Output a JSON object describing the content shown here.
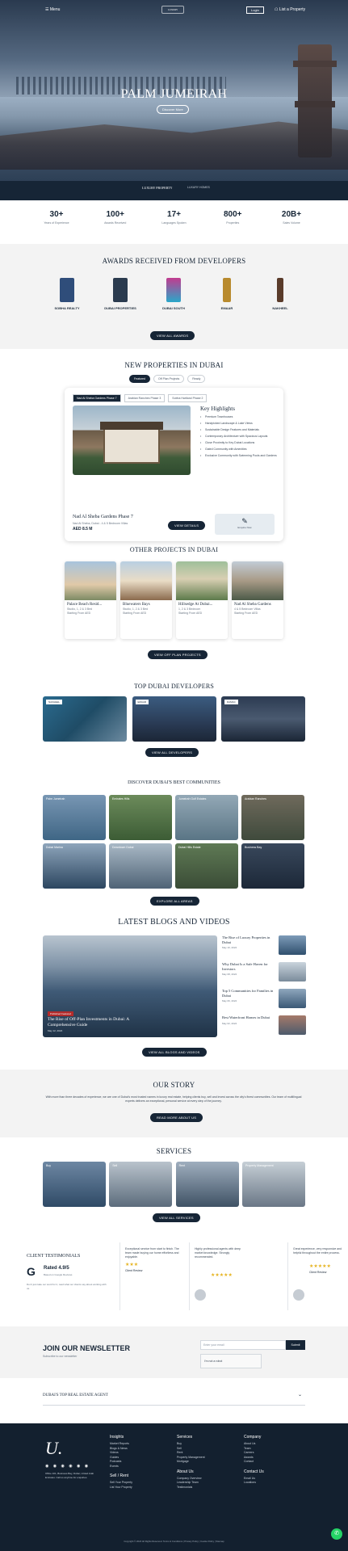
{
  "header": {
    "menu": "☰ Menu",
    "logo": "LUXURY",
    "login": "Login",
    "list_property": "☖ List a Property"
  },
  "hero": {
    "title": "PALM JUMEIRAH",
    "cta": "Discover More",
    "brand": "LUXURY PROPERTY",
    "brand2": "LUXURY HOMES"
  },
  "stats": [
    {
      "num": "30+",
      "label": "Years of Experience"
    },
    {
      "num": "100+",
      "label": "Awards Received"
    },
    {
      "num": "17+",
      "label": "Languages Spoken"
    },
    {
      "num": "800+",
      "label": "Properties"
    },
    {
      "num": "20B+",
      "label": "Sales Volume"
    }
  ],
  "awards": {
    "title": "AWARDS RECEIVED FROM DEVELOPERS",
    "items": [
      {
        "name": "SOBHA REALTY",
        "color": "#2f4d7a"
      },
      {
        "name": "DUBAI PROPERTIES",
        "color": "#2b3b4f"
      },
      {
        "name": "DUBAI SOUTH",
        "color": "#c23b8f"
      },
      {
        "name": "EMAAR",
        "color": "#b88a2e"
      },
      {
        "name": "NAKHEEL",
        "color": "#5a3b2a"
      }
    ],
    "cta": "View All Awards"
  },
  "new_properties": {
    "title": "NEW PROPERTIES IN DUBAI",
    "tabs": [
      "Featured",
      "Off Plan Projects",
      "Ready"
    ],
    "subtabs": [
      "Nad Al Sheba Gardens Phase 7",
      "Arabian Ranches Phase 3",
      "Sobha Hartland Phase 2"
    ],
    "highlights_title": "Key Highlights",
    "highlights": [
      "Premium Townhouses",
      "Handpicked Landscape & Lake Views",
      "Sustainable Design Features and Materials",
      "Contemporary Architecture with Spacious Layouts",
      "Close Proximity to Key Dubai Locations",
      "Gated Community with Amenities",
      "Exclusive Community with Swimming Pools and Gardens"
    ],
    "property_title": "Nad Al Sheba Gardens Phase 7",
    "property_loc": "Nad Al Sheba, Dubai - 4 & 5 Bedroom Villas",
    "property_price": "AED 8.5 M",
    "property_cta": "View Details",
    "enquire": "Enquire Now"
  },
  "other_projects": {
    "title": "OTHER PROJECTS IN DUBAI",
    "items": [
      {
        "title": "Palace Beach Resid...",
        "desc1": "Studio, 1, 2 & 3 Bed",
        "desc2": "Starting From AED"
      },
      {
        "title": "Bluewaters Bays",
        "desc1": "Studio, 1, 2 & 3 Bed",
        "desc2": "Starting From AED"
      },
      {
        "title": "Hillsedge At Dubai...",
        "desc1": "1, 2 & 3 Bedroom",
        "desc2": "Starting From AED"
      },
      {
        "title": "Nad Al Sheba Gardens",
        "desc1": "4 & 5 Bedroom Villas",
        "desc2": "Starting From AED"
      }
    ],
    "cta": "View Off Plan Projects"
  },
  "developers": {
    "title": "TOP DUBAI DEVELOPERS",
    "items": [
      "NAKHEEL",
      "EMAAR",
      "DAMAC"
    ],
    "cta": "View All Developers"
  },
  "communities": {
    "title": "DISCOVER DUBAI'S BEST COMMUNITIES",
    "items": [
      "Palm Jumeirah",
      "Emirates Hills",
      "Jumeirah Golf Estates",
      "Arabian Ranches",
      "Dubai Marina",
      "Downtown Dubai",
      "Dubai Hills Estate",
      "Business Bay"
    ],
    "cta": "Explore All Areas"
  },
  "blogs": {
    "title": "LATEST BLOGS AND VIDEOS",
    "main": {
      "tag": "Published Featured",
      "title": "The Rise of Off-Plan Investments in Dubai: A Comprehensive Guide",
      "date": "May 12, 2024"
    },
    "items": [
      {
        "title": "The Rise of Luxury Properties in Dubai",
        "date": "May 10, 2024"
      },
      {
        "title": "Why Dubai Is a Safe Haven for Investors",
        "date": "May 08, 2024"
      },
      {
        "title": "Top 5 Communities for Families in Dubai",
        "date": "May 06, 2024"
      },
      {
        "title": "Best Waterfront Homes in Dubai",
        "date": "May 02, 2024"
      }
    ],
    "cta": "View All Blogs and Videos"
  },
  "story": {
    "title": "OUR STORY",
    "text": "With more than three decades of experience, we are one of Dubai's most trusted names in luxury real estate, helping clients buy, sell and invest across the city's finest communities. Our team of multilingual experts delivers an exceptional, personal service at every step of the journey.",
    "cta": "Read More About Us"
  },
  "services": {
    "title": "SERVICES",
    "items": [
      "Buy",
      "Sell",
      "Rent",
      "Property Management"
    ],
    "cta": "View All Services"
  },
  "testimonials": {
    "title": "CLIENT TESTIMONIALS",
    "rating": "Rated 4.9/5",
    "based": "Based on Google Reviews",
    "desc": "Don't just take our word for it, read what our clients say about working with us.",
    "items": [
      {
        "text": "Exceptional service from start to finish. The team made buying our home effortless and enjoyable.",
        "name": "Client Review"
      },
      {
        "text": "Highly professional agents with deep market knowledge. Strongly recommended.",
        "name": "Client Review"
      },
      {
        "text": "Great experience, very responsive and helpful throughout the entire process.",
        "name": "Client Review"
      }
    ]
  },
  "newsletter": {
    "title": "JOIN OUR NEWSLETTER",
    "sub": "Subscribe to our newsletter",
    "placeholder": "Enter your email",
    "btn": "Submit",
    "captcha": "I'm not a robot"
  },
  "faq": {
    "label": "DUBAI'S TOP REAL ESTATE AGENT",
    "chevron": "⌄"
  },
  "footer": {
    "logo": "U.",
    "socials": "◉ ◉ ◉ ◉ ◉ ◉",
    "address": "Office 101, Business Bay, Dubai, United Arab Emirates. Call us anytime for enquiries.",
    "cols": [
      {
        "h": "Insights",
        "items": [
          "Market Reports",
          "Blogs & News",
          "Videos",
          "Guides",
          "Podcasts",
          "Events"
        ]
      },
      {
        "h": "Services",
        "items": [
          "Buy",
          "Sell",
          "Rent",
          "Property Management",
          "Mortgage"
        ]
      },
      {
        "h": "Company",
        "items": [
          "About Us",
          "Team",
          "Careers",
          "Awards",
          "Contact"
        ]
      }
    ],
    "col2b": {
      "h": "About Us",
      "items": [
        "Company Overview",
        "Leadership Team",
        "Testimonials"
      ]
    },
    "col1b": {
      "h": "Sell / Rent",
      "items": [
        "Sell Your Property",
        "List Your Property"
      ]
    },
    "col3b": {
      "h": "Contact Us",
      "items": [
        "Email Us",
        "Locations"
      ]
    },
    "copyright": "Copyright © 2024 All Rights Reserved. Terms & Conditions | Privacy Policy | Cookie Policy | Sitemap"
  },
  "whatsapp": "✆"
}
